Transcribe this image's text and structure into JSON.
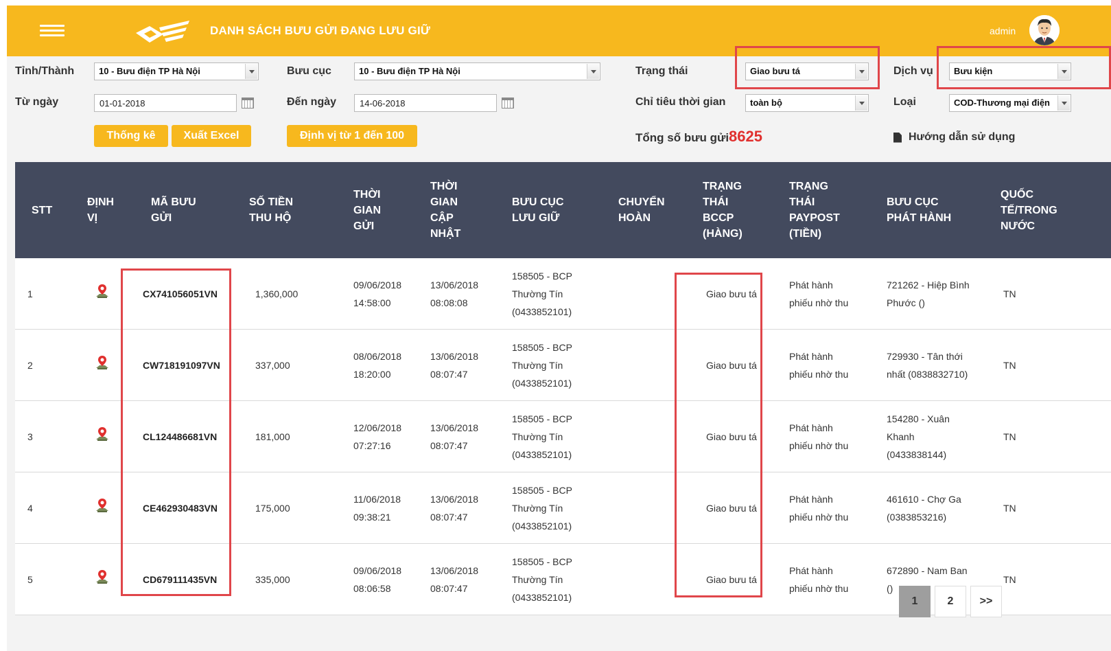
{
  "header": {
    "title": "DANH SÁCH BƯU GỬI ĐANG LƯU GIỮ",
    "user": "admin",
    "accent_color": "#f7b81e"
  },
  "filters": {
    "province": {
      "label": "Tỉnh/Thành",
      "value": "10 - Bưu điện TP Hà Nội"
    },
    "post_office": {
      "label": "Bưu cục",
      "value": "10 - Bưu điện TP Hà Nội"
    },
    "status": {
      "label": "Trạng thái",
      "value": "Giao bưu tá"
    },
    "service": {
      "label": "Dịch vụ",
      "value": "Bưu kiện"
    },
    "from_date": {
      "label": "Từ ngày",
      "value": "01-01-2018"
    },
    "to_date": {
      "label": "Đến ngày",
      "value": "14-06-2018"
    },
    "time_metric": {
      "label": "Chỉ tiêu thời gian",
      "value": "toàn bộ"
    },
    "type": {
      "label": "Loại",
      "value": "COD-Thương mại điện"
    }
  },
  "actions": {
    "stats": "Thống kê",
    "export": "Xuất Excel",
    "locate": "Định vị từ 1 đến 100"
  },
  "summary": {
    "label": "Tổng số bưu gửi",
    "total": "8625"
  },
  "help": {
    "label": "Hướng dẫn sử dụng"
  },
  "table": {
    "columns": {
      "stt": "STT",
      "locate": [
        "ĐỊNH",
        "VỊ"
      ],
      "code": [
        "MÃ BƯU",
        "GỬI"
      ],
      "cod": [
        "SỐ TIỀN",
        "THU HỘ"
      ],
      "sent": [
        "THỜI",
        "GIAN",
        "GỬI"
      ],
      "updated": [
        "THỜI",
        "GIAN",
        "CẬP",
        "NHẬT"
      ],
      "office": [
        "BƯU CỤC",
        "LƯU GIỮ"
      ],
      "return": [
        "CHUYỂN",
        "HOÀN"
      ],
      "bccp": [
        "TRẠNG",
        "THÁI",
        "BCCP",
        "(HÀNG)"
      ],
      "paypost": [
        "TRẠNG",
        "THÁI",
        "PAYPOST",
        "(TIỀN)"
      ],
      "issuer": [
        "BƯU CỤC",
        "PHÁT HÀNH"
      ],
      "scope": [
        "QUỐC",
        "TẾ/TRONG",
        "NƯỚC"
      ]
    },
    "rows": [
      {
        "stt": "1",
        "code": "CX741056051VN",
        "cod": "1,360,000",
        "sent": [
          "09/06/2018",
          "14:58:00"
        ],
        "updated": [
          "13/06/2018",
          "08:08:08"
        ],
        "office": [
          "158505 - BCP",
          "Thường Tín",
          "(0433852101)"
        ],
        "return": "",
        "bccp": "Giao bưu tá",
        "paypost": [
          "Phát hành",
          "phiếu nhờ thu"
        ],
        "issuer": [
          "721262 - Hiệp Bình",
          "Phước ()"
        ],
        "scope": "TN"
      },
      {
        "stt": "2",
        "code": "CW718191097VN",
        "cod": "337,000",
        "sent": [
          "08/06/2018",
          "18:20:00"
        ],
        "updated": [
          "13/06/2018",
          "08:07:47"
        ],
        "office": [
          "158505 - BCP",
          "Thường Tín",
          "(0433852101)"
        ],
        "return": "",
        "bccp": "Giao bưu tá",
        "paypost": [
          "Phát hành",
          "phiếu nhờ thu"
        ],
        "issuer": [
          "729930 - Tân thới",
          "nhất (0838832710)"
        ],
        "scope": "TN"
      },
      {
        "stt": "3",
        "code": "CL124486681VN",
        "cod": "181,000",
        "sent": [
          "12/06/2018",
          "07:27:16"
        ],
        "updated": [
          "13/06/2018",
          "08:07:47"
        ],
        "office": [
          "158505 - BCP",
          "Thường Tín",
          "(0433852101)"
        ],
        "return": "",
        "bccp": "Giao bưu tá",
        "paypost": [
          "Phát hành",
          "phiếu nhờ thu"
        ],
        "issuer": [
          "154280 - Xuân",
          "Khanh",
          "(0433838144)"
        ],
        "scope": "TN"
      },
      {
        "stt": "4",
        "code": "CE462930483VN",
        "cod": "175,000",
        "sent": [
          "11/06/2018",
          "09:38:21"
        ],
        "updated": [
          "13/06/2018",
          "08:07:47"
        ],
        "office": [
          "158505 - BCP",
          "Thường Tín",
          "(0433852101)"
        ],
        "return": "",
        "bccp": "Giao bưu tá",
        "paypost": [
          "Phát hành",
          "phiếu nhờ thu"
        ],
        "issuer": [
          "461610 - Chợ Ga",
          "(0383853216)"
        ],
        "scope": "TN"
      },
      {
        "stt": "5",
        "code": "CD679111435VN",
        "cod": "335,000",
        "sent": [
          "09/06/2018",
          "08:06:58"
        ],
        "updated": [
          "13/06/2018",
          "08:07:47"
        ],
        "office": [
          "158505 - BCP",
          "Thường Tín",
          "(0433852101)"
        ],
        "return": "",
        "bccp": "Giao bưu tá",
        "paypost": [
          "Phát hành",
          "phiếu nhờ thu"
        ],
        "issuer": [
          "672890 - Nam Ban",
          "()"
        ],
        "scope": "TN"
      }
    ]
  },
  "pagination": {
    "pages": [
      "1",
      "2"
    ],
    "next": ">>",
    "current": "1"
  }
}
